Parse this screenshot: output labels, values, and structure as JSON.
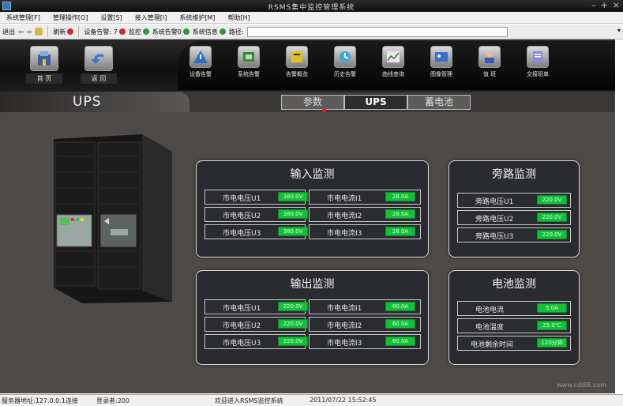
{
  "window": {
    "title": "RSMS集中监控管理系统"
  },
  "menu": [
    "系统管理[F]",
    "管理操作[O]",
    "设置[S]",
    "接入管理[I]",
    "系统维护[M]",
    "帮助[H]"
  ],
  "toolbar": {
    "exit_label": "退出",
    "refresh_label": "刷新",
    "alarm_count_label": "设备告警: 7",
    "monitor_label": "监控",
    "guard_label": "系统告警0",
    "system_label": "系统信息",
    "path_label": "路径:"
  },
  "nav": {
    "home": "首 页",
    "back": "返 回",
    "device_alarm": "设备告警",
    "system_alarm": "系统告警",
    "alarm_browse": "告警概览",
    "history_alarm": "历史告警",
    "curve_query": "曲线查询",
    "image_manage": "图像管理",
    "duty": "值 班",
    "handover": "交接班单"
  },
  "page": {
    "title": "UPS",
    "tabs": [
      "参数",
      "UPS",
      "蓄电池"
    ],
    "active_tab": 1
  },
  "input_panel": {
    "title": "输入监测",
    "rows": [
      {
        "label": "市电电压U1",
        "value": "380.0V",
        "label2": "市电电流I1",
        "value2": "28.0A"
      },
      {
        "label": "市电电压U2",
        "value": "380.0V",
        "label2": "市电电流I2",
        "value2": "28.0A"
      },
      {
        "label": "市电电压U3",
        "value": "380.0V",
        "label2": "市电电流I3",
        "value2": "28.0A"
      }
    ]
  },
  "output_panel": {
    "title": "输出监测",
    "rows": [
      {
        "label": "市电电压U1",
        "value": "220.0V",
        "label2": "市电电流I1",
        "value2": "60.0A"
      },
      {
        "label": "市电电压U2",
        "value": "220.0V",
        "label2": "市电电流I2",
        "value2": "60.0A"
      },
      {
        "label": "市电电压U3",
        "value": "220.0V",
        "label2": "市电电流I3",
        "value2": "60.0A"
      }
    ]
  },
  "bypass_panel": {
    "title": "旁路监测",
    "rows": [
      {
        "label": "旁路电压U1",
        "value": "220.0V"
      },
      {
        "label": "旁路电压U2",
        "value": "220.0V"
      },
      {
        "label": "旁路电压U3",
        "value": "220.0V"
      }
    ]
  },
  "battery_panel": {
    "title": "电池监测",
    "rows": [
      {
        "label": "电池电流",
        "value": "5.0A"
      },
      {
        "label": "电池温度",
        "value": "25.0℃"
      },
      {
        "label": "电池剩余时间",
        "value": "120分钟"
      }
    ]
  },
  "status": {
    "server": "服务器地址:127.0.0.1连接",
    "user": "登录者:200",
    "welcome": "欢迎进入RSMS监控系统",
    "datetime": "2011/07/22 15:52:45"
  },
  "watermark": "www.cdi88.com",
  "colors": {
    "value_green": "#13c03a",
    "panel_bg": "#2a2b2f",
    "app_bg": "#4b4846"
  }
}
